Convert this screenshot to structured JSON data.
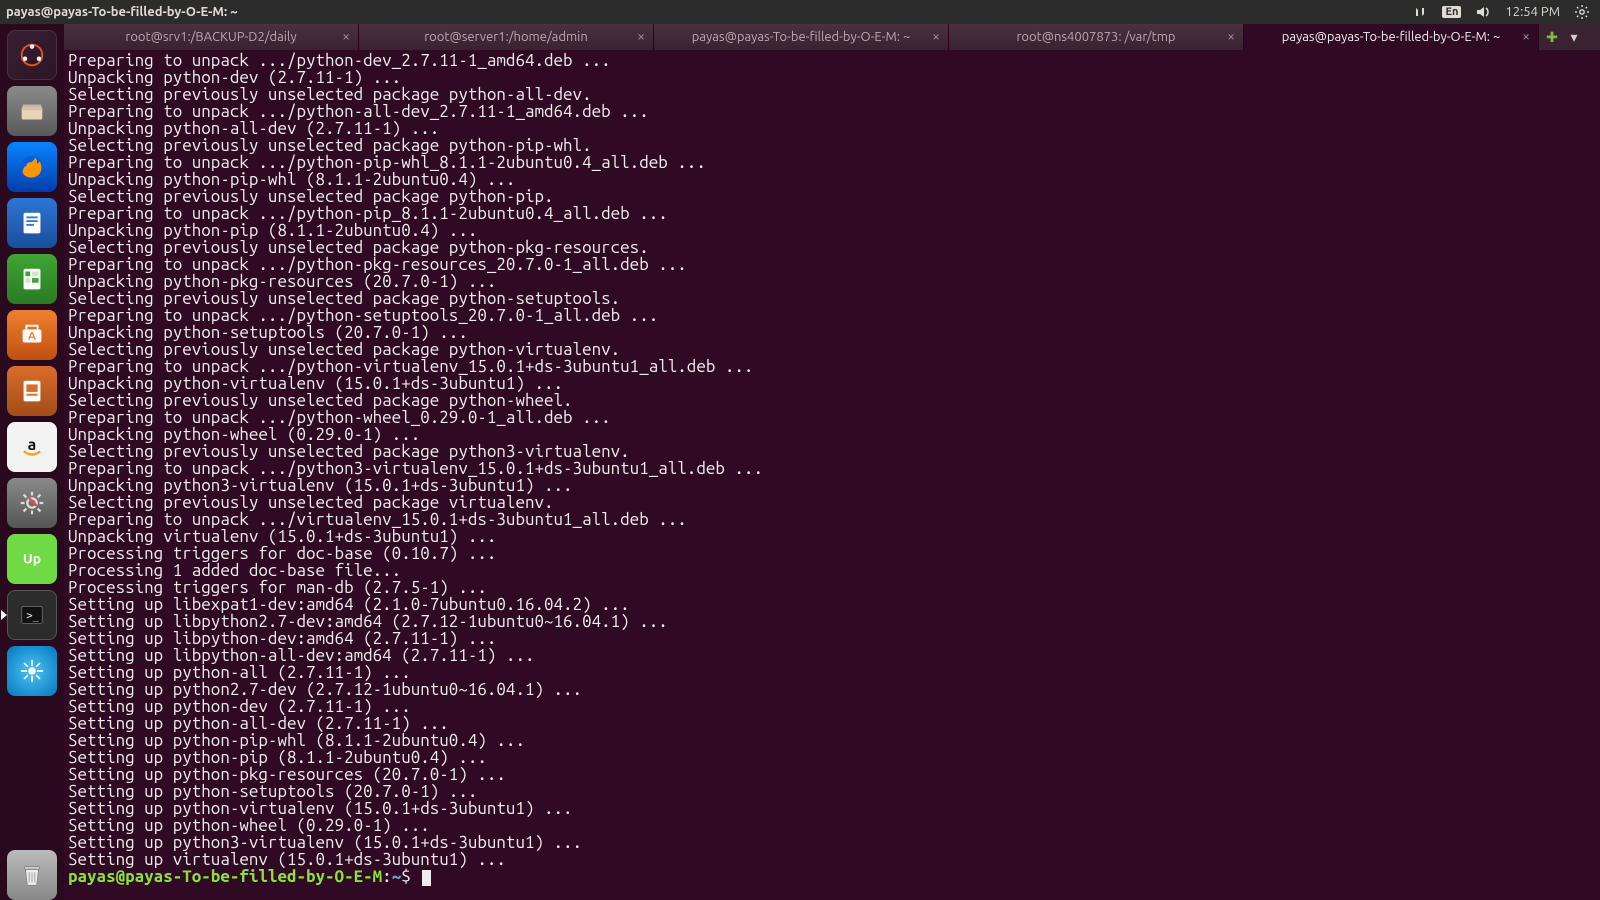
{
  "panel": {
    "title": "payas@payas-To-be-filled-by-O-E-M: ~",
    "lang": "En",
    "time": "12:54 PM"
  },
  "tabs": {
    "items": [
      {
        "label": "root@srv1:/BACKUP-D2/daily"
      },
      {
        "label": "root@server1:/home/admin"
      },
      {
        "label": "payas@payas-To-be-filled-by-O-E-M: ~"
      },
      {
        "label": "root@ns4007873: /var/tmp"
      },
      {
        "label": "payas@payas-To-be-filled-by-O-E-M: ~"
      }
    ],
    "active_index": 4
  },
  "launcher": {
    "items": [
      {
        "name": "dash",
        "cls": "ic-dash"
      },
      {
        "name": "files",
        "cls": "ic-files"
      },
      {
        "name": "firefox",
        "cls": "ic-ff"
      },
      {
        "name": "writer",
        "cls": "ic-writer"
      },
      {
        "name": "calc",
        "cls": "ic-calc"
      },
      {
        "name": "software",
        "cls": "ic-sw"
      },
      {
        "name": "impress",
        "cls": "ic-impr"
      },
      {
        "name": "amazon",
        "cls": "ic-amz"
      },
      {
        "name": "settings",
        "cls": "ic-sys"
      },
      {
        "name": "upwork",
        "cls": "ic-up"
      },
      {
        "name": "terminal",
        "cls": "ic-term",
        "active": true
      },
      {
        "name": "app-blue",
        "cls": "ic-blue"
      }
    ],
    "trash_name": "trash"
  },
  "terminal": {
    "lines": [
      "Preparing to unpack .../python-dev_2.7.11-1_amd64.deb ...",
      "Unpacking python-dev (2.7.11-1) ...",
      "Selecting previously unselected package python-all-dev.",
      "Preparing to unpack .../python-all-dev_2.7.11-1_amd64.deb ...",
      "Unpacking python-all-dev (2.7.11-1) ...",
      "Selecting previously unselected package python-pip-whl.",
      "Preparing to unpack .../python-pip-whl_8.1.1-2ubuntu0.4_all.deb ...",
      "Unpacking python-pip-whl (8.1.1-2ubuntu0.4) ...",
      "Selecting previously unselected package python-pip.",
      "Preparing to unpack .../python-pip_8.1.1-2ubuntu0.4_all.deb ...",
      "Unpacking python-pip (8.1.1-2ubuntu0.4) ...",
      "Selecting previously unselected package python-pkg-resources.",
      "Preparing to unpack .../python-pkg-resources_20.7.0-1_all.deb ...",
      "Unpacking python-pkg-resources (20.7.0-1) ...",
      "Selecting previously unselected package python-setuptools.",
      "Preparing to unpack .../python-setuptools_20.7.0-1_all.deb ...",
      "Unpacking python-setuptools (20.7.0-1) ...",
      "Selecting previously unselected package python-virtualenv.",
      "Preparing to unpack .../python-virtualenv_15.0.1+ds-3ubuntu1_all.deb ...",
      "Unpacking python-virtualenv (15.0.1+ds-3ubuntu1) ...",
      "Selecting previously unselected package python-wheel.",
      "Preparing to unpack .../python-wheel_0.29.0-1_all.deb ...",
      "Unpacking python-wheel (0.29.0-1) ...",
      "Selecting previously unselected package python3-virtualenv.",
      "Preparing to unpack .../python3-virtualenv_15.0.1+ds-3ubuntu1_all.deb ...",
      "Unpacking python3-virtualenv (15.0.1+ds-3ubuntu1) ...",
      "Selecting previously unselected package virtualenv.",
      "Preparing to unpack .../virtualenv_15.0.1+ds-3ubuntu1_all.deb ...",
      "Unpacking virtualenv (15.0.1+ds-3ubuntu1) ...",
      "Processing triggers for doc-base (0.10.7) ...",
      "Processing 1 added doc-base file...",
      "Processing triggers for man-db (2.7.5-1) ...",
      "Setting up libexpat1-dev:amd64 (2.1.0-7ubuntu0.16.04.2) ...",
      "Setting up libpython2.7-dev:amd64 (2.7.12-1ubuntu0~16.04.1) ...",
      "Setting up libpython-dev:amd64 (2.7.11-1) ...",
      "Setting up libpython-all-dev:amd64 (2.7.11-1) ...",
      "Setting up python-all (2.7.11-1) ...",
      "Setting up python2.7-dev (2.7.12-1ubuntu0~16.04.1) ...",
      "Setting up python-dev (2.7.11-1) ...",
      "Setting up python-all-dev (2.7.11-1) ...",
      "Setting up python-pip-whl (8.1.1-2ubuntu0.4) ...",
      "Setting up python-pip (8.1.1-2ubuntu0.4) ...",
      "Setting up python-pkg-resources (20.7.0-1) ...",
      "Setting up python-setuptools (20.7.0-1) ...",
      "Setting up python-virtualenv (15.0.1+ds-3ubuntu1) ...",
      "Setting up python-wheel (0.29.0-1) ...",
      "Setting up python3-virtualenv (15.0.1+ds-3ubuntu1) ...",
      "Setting up virtualenv (15.0.1+ds-3ubuntu1) ..."
    ],
    "prompt_user": "payas@payas-To-be-filled-by-O-E-M",
    "prompt_sep": ":",
    "prompt_path": "~",
    "prompt_char": "$"
  }
}
